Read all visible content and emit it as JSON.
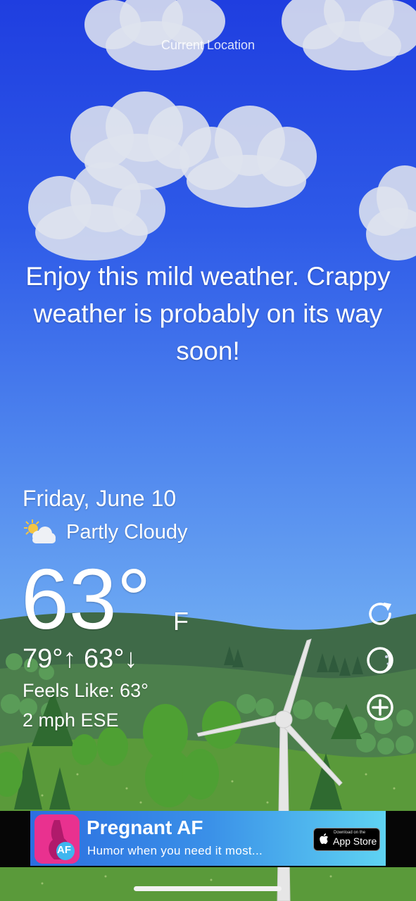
{
  "location": "Current Location",
  "message": "Enjoy this mild weather. Crappy weather is probably on its way soon!",
  "date": "Friday, June 10",
  "condition": {
    "label": "Partly Cloudy",
    "icon": "partly-cloudy-icon"
  },
  "temperature": {
    "value": "63°",
    "unit": "F"
  },
  "high_low": "79°↑ 63°↓",
  "feels_like": "Feels Like: 63°",
  "wind": "2 mph ESE",
  "controls": {
    "refresh": "refresh-icon",
    "theme": "moon-phase-icon",
    "add": "add-circle-icon"
  },
  "ad": {
    "title": "Pregnant AF",
    "subtitle": "Humor when you need it most...",
    "icon_text": "AF",
    "store_small": "Download on the",
    "store_big": "App Store"
  },
  "colors": {
    "sky_top": "#1f3ee0",
    "sky_bottom": "#7cb6f4",
    "grass": "#5a9a3a",
    "hills": "#3f6a48"
  }
}
